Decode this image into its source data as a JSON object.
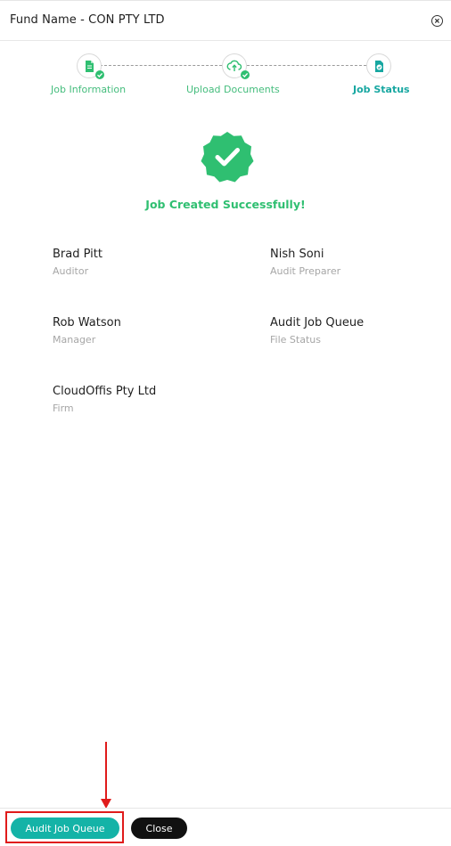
{
  "header": {
    "title": "Fund Name - CON PTY LTD",
    "close_icon": "close-circle-icon"
  },
  "stepper": {
    "steps": [
      {
        "label": "Job Information",
        "icon": "document-icon",
        "state": "completed"
      },
      {
        "label": "Upload Documents",
        "icon": "cloud-upload-icon",
        "state": "completed"
      },
      {
        "label": "Job Status",
        "icon": "job-status-icon",
        "state": "active"
      }
    ]
  },
  "status": {
    "icon": "verified-badge-icon",
    "message": "Job Created Successfully!"
  },
  "details": [
    {
      "name": "Brad Pitt",
      "role": "Auditor"
    },
    {
      "name": "Nish Soni",
      "role": "Audit Preparer"
    },
    {
      "name": "Rob Watson",
      "role": "Manager"
    },
    {
      "name": "Audit Job Queue",
      "role": "File Status"
    },
    {
      "name": "CloudOffis Pty Ltd",
      "role": "Firm"
    }
  ],
  "footer": {
    "primary_label": "Audit Job Queue",
    "secondary_label": "Close"
  },
  "colors": {
    "accent_teal": "#14b3a7",
    "success_green": "#2fbf71",
    "annotation_red": "#e01b1b"
  }
}
